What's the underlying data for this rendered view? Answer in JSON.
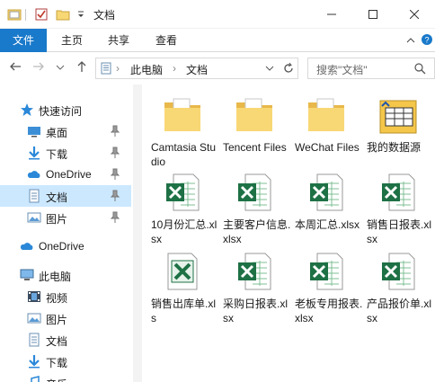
{
  "window": {
    "title": "文档"
  },
  "ribbon": {
    "tabs": [
      "文件",
      "主页",
      "共享",
      "查看"
    ]
  },
  "address": {
    "crumbs": [
      "此电脑",
      "文档"
    ]
  },
  "search": {
    "placeholder": "搜索\"文档\""
  },
  "nav": {
    "quick_access": "快速访问",
    "items": [
      {
        "label": "桌面",
        "icon": "desktop-folder-icon",
        "pinned": true
      },
      {
        "label": "下载",
        "icon": "download-folder-icon",
        "pinned": true
      },
      {
        "label": "OneDrive",
        "icon": "onedrive-cloud-icon",
        "pinned": true
      },
      {
        "label": "文档",
        "icon": "documents-folder-icon",
        "pinned": true,
        "selected": true
      },
      {
        "label": "图片",
        "icon": "pictures-folder-icon",
        "pinned": true
      }
    ],
    "onedrive": "OneDrive",
    "this_pc": "此电脑",
    "pc_items": [
      {
        "label": "视频",
        "icon": "videos-folder-icon"
      },
      {
        "label": "图片",
        "icon": "pictures-folder-icon"
      },
      {
        "label": "文档",
        "icon": "documents-folder-icon"
      },
      {
        "label": "下载",
        "icon": "download-folder-icon"
      },
      {
        "label": "音乐",
        "icon": "music-folder-icon"
      }
    ]
  },
  "files": [
    {
      "name": "Camtasia Studio",
      "type": "folder"
    },
    {
      "name": "Tencent Files",
      "type": "folder"
    },
    {
      "name": "WeChat Files",
      "type": "folder"
    },
    {
      "name": "我的数据源",
      "type": "data-source"
    },
    {
      "name": "10月份汇总.xlsx",
      "type": "excel"
    },
    {
      "name": "主要客户信息.xlsx",
      "type": "excel"
    },
    {
      "name": "本周汇总.xlsx",
      "type": "excel"
    },
    {
      "name": "销售日报表.xlsx",
      "type": "excel"
    },
    {
      "name": "销售出库单.xls",
      "type": "excel-legacy"
    },
    {
      "name": "采购日报表.xlsx",
      "type": "excel"
    },
    {
      "name": "老板专用报表.xlsx",
      "type": "excel"
    },
    {
      "name": "产品报价单.xlsx",
      "type": "excel"
    }
  ],
  "colors": {
    "accent": "#1979ca",
    "selection": "#cce8ff",
    "excel_green": "#1e7145",
    "folder_yellow": "#f8d775"
  }
}
